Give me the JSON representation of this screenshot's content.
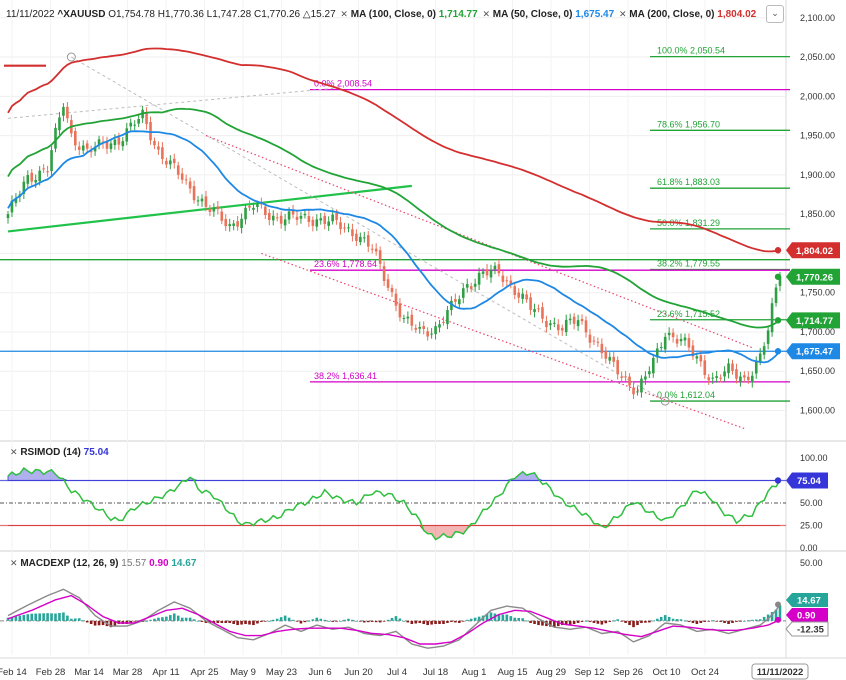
{
  "header": {
    "date": "11/11/2022",
    "symbol": "^XAUUSD",
    "ohlc": {
      "o": "1,754.78",
      "h": "1,770.36",
      "l": "1,747.28",
      "c": "1,770.26",
      "chg": "15.27"
    },
    "ma100": {
      "label": "MA (100, Close, 0)",
      "value": "1,714.77",
      "color": "#21a336"
    },
    "ma50": {
      "label": "MA (50, Close, 0)",
      "value": "1,675.47",
      "color": "#1e88e5"
    },
    "ma200": {
      "label": "MA (200, Close, 0)",
      "value": "1,804.02",
      "color": "#d32f2f"
    }
  },
  "rsi_legend": {
    "label": "RSIMOD (14)",
    "value": "75.04",
    "color": "#3535d9"
  },
  "macd_legend": {
    "label": "MACDEXP (12, 26, 9)",
    "v1": "15.57",
    "v2": "0.90",
    "v3": "14.67"
  },
  "chart_data": [
    {
      "type": "candlestick",
      "title": "^XAUUSD",
      "y_ticks": [
        "2,100.00",
        "2,050.00",
        "2,000.00",
        "1,950.00",
        "1,900.00",
        "1,850.00",
        "1,800.00",
        "1,750.00",
        "1,700.00",
        "1,650.00",
        "1,600.00"
      ],
      "ylim": [
        1565,
        2115
      ],
      "x_ticks": [
        "Feb 14",
        "Feb 28",
        "Mar 14",
        "Mar 28",
        "Apr 11",
        "Apr 25",
        "May 9",
        "May 23",
        "Jun 6",
        "Jun 20",
        "Jul 4",
        "Jul 18",
        "Aug 1",
        "Aug 15",
        "Aug 29",
        "Sep 12",
        "Sep 26",
        "Oct 10",
        "Oct 24"
      ],
      "x_highlight": "11/11/2022",
      "close_keypoints": [
        [
          0,
          1850
        ],
        [
          5,
          1895
        ],
        [
          10,
          1910
        ],
        [
          14,
          1990
        ],
        [
          16,
          1950
        ],
        [
          20,
          1930
        ],
        [
          28,
          1945
        ],
        [
          34,
          1975
        ],
        [
          38,
          1930
        ],
        [
          44,
          1895
        ],
        [
          50,
          1860
        ],
        [
          56,
          1835
        ],
        [
          62,
          1860
        ],
        [
          68,
          1845
        ],
        [
          76,
          1845
        ],
        [
          82,
          1840
        ],
        [
          88,
          1825
        ],
        [
          92,
          1805
        ],
        [
          96,
          1760
        ],
        [
          100,
          1715
        ],
        [
          104,
          1700
        ],
        [
          108,
          1705
        ],
        [
          112,
          1730
        ],
        [
          116,
          1760
        ],
        [
          120,
          1775
        ],
        [
          124,
          1775
        ],
        [
          128,
          1755
        ],
        [
          132,
          1730
        ],
        [
          136,
          1715
        ],
        [
          140,
          1705
        ],
        [
          144,
          1715
        ],
        [
          148,
          1690
        ],
        [
          152,
          1660
        ],
        [
          156,
          1640
        ],
        [
          159,
          1625
        ],
        [
          163,
          1660
        ],
        [
          166,
          1700
        ],
        [
          170,
          1690
        ],
        [
          174,
          1665
        ],
        [
          178,
          1640
        ],
        [
          182,
          1650
        ],
        [
          186,
          1640
        ],
        [
          188,
          1652
        ],
        [
          190,
          1668
        ],
        [
          192,
          1700
        ],
        [
          194,
          1755
        ],
        [
          195,
          1770.26
        ]
      ],
      "ma_last": [
        {
          "name": "MA (200, Close, 0)",
          "value": 1804.02,
          "color": "#d32f2f",
          "label": "1,804.02"
        },
        {
          "name": "MA (100, Close, 0)",
          "value": 1714.77,
          "color": "#21a336",
          "label": "1,714.77"
        },
        {
          "name": "MA (50, Close, 0)",
          "value": 1675.47,
          "color": "#1e88e5",
          "label": "1,675.47"
        }
      ],
      "last_price": {
        "value": 1770.26,
        "label": "1,770.26"
      },
      "fib_upper": [
        {
          "pct": "100.0%",
          "value": 2050.54,
          "label": "100.0% 2,050.54"
        },
        {
          "pct": "78.6%",
          "value": 1956.7,
          "label": "78.6% 1,956.70"
        },
        {
          "pct": "61.8%",
          "value": 1883.03,
          "label": "61.8% 1,883.03"
        },
        {
          "pct": "50.0%",
          "value": 1831.29,
          "label": "50.0% 1,831.29"
        },
        {
          "pct": "38.2%",
          "value": 1779.55,
          "label": "38.2% 1,779.55"
        },
        {
          "pct": "23.6%",
          "value": 1715.52,
          "label": "23.6% 1,715.52"
        },
        {
          "pct": "0.0%",
          "value": 1612.04,
          "label": "0.0% 1,612.04"
        }
      ],
      "fib_lower": [
        {
          "pct": "0.0%",
          "value": 2008.54,
          "label": "0.0% 2,008.54"
        },
        {
          "pct": "23.6%",
          "value": 1778.64,
          "label": "23.6% 1,778.64"
        },
        {
          "pct": "38.2%",
          "value": 1636.41,
          "label": "38.2% 1,636.41"
        }
      ],
      "colors": {
        "up": "#2f9e44",
        "down": "#e8735a",
        "fib_upper": "#21a336",
        "fib_lower": "#d400c8"
      }
    },
    {
      "type": "line",
      "title": "RSIMOD (14)",
      "y_ticks": [
        "100.00",
        "75.00",
        "50.00",
        "25.00",
        "0.00"
      ],
      "ylim": [
        0,
        100
      ],
      "levels": [
        75,
        50,
        25
      ],
      "last_value": {
        "value": 75.04,
        "label": "75.04"
      },
      "keypoints": [
        [
          0,
          80
        ],
        [
          4,
          86
        ],
        [
          8,
          85
        ],
        [
          12,
          84
        ],
        [
          16,
          64
        ],
        [
          20,
          52
        ],
        [
          24,
          40
        ],
        [
          26,
          33
        ],
        [
          28,
          30
        ],
        [
          32,
          45
        ],
        [
          36,
          52
        ],
        [
          40,
          60
        ],
        [
          44,
          72
        ],
        [
          46,
          80
        ],
        [
          48,
          66
        ],
        [
          52,
          58
        ],
        [
          56,
          40
        ],
        [
          58,
          30
        ],
        [
          60,
          26
        ],
        [
          64,
          30
        ],
        [
          68,
          34
        ],
        [
          72,
          45
        ],
        [
          76,
          52
        ],
        [
          80,
          62
        ],
        [
          84,
          54
        ],
        [
          88,
          50
        ],
        [
          92,
          62
        ],
        [
          96,
          60
        ],
        [
          100,
          50
        ],
        [
          104,
          30
        ],
        [
          106,
          15
        ],
        [
          108,
          12
        ],
        [
          112,
          14
        ],
        [
          116,
          20
        ],
        [
          120,
          40
        ],
        [
          124,
          58
        ],
        [
          128,
          80
        ],
        [
          132,
          84
        ],
        [
          136,
          70
        ],
        [
          140,
          52
        ],
        [
          144,
          42
        ],
        [
          148,
          30
        ],
        [
          150,
          22
        ],
        [
          154,
          35
        ],
        [
          158,
          52
        ],
        [
          162,
          40
        ],
        [
          166,
          30
        ],
        [
          170,
          45
        ],
        [
          174,
          65
        ],
        [
          178,
          54
        ],
        [
          180,
          42
        ],
        [
          184,
          30
        ],
        [
          188,
          38
        ],
        [
          192,
          62
        ],
        [
          195,
          75.04
        ]
      ]
    },
    {
      "type": "histogram",
      "title": "MACDEXP (12, 26, 9)",
      "ylim": [
        -22,
        55
      ],
      "axis_labels": [
        "50.00",
        "-12.35"
      ],
      "last_values": [
        {
          "value": 14.67,
          "label": "14.67"
        },
        {
          "value": 0.9,
          "label": "0.90"
        },
        {
          "value": -12.35,
          "label": "-12.35"
        }
      ],
      "macd_keypoints": [
        [
          0,
          5
        ],
        [
          5,
          15
        ],
        [
          10,
          24
        ],
        [
          14,
          30
        ],
        [
          18,
          22
        ],
        [
          22,
          5
        ],
        [
          26,
          -5
        ],
        [
          30,
          -5
        ],
        [
          34,
          0
        ],
        [
          38,
          10
        ],
        [
          42,
          18
        ],
        [
          46,
          12
        ],
        [
          50,
          0
        ],
        [
          54,
          -8
        ],
        [
          58,
          -16
        ],
        [
          62,
          -18
        ],
        [
          66,
          -12
        ],
        [
          70,
          -4
        ],
        [
          74,
          -10
        ],
        [
          78,
          -4
        ],
        [
          82,
          -8
        ],
        [
          86,
          -6
        ],
        [
          90,
          -12
        ],
        [
          94,
          -14
        ],
        [
          98,
          -10
        ],
        [
          102,
          -22
        ],
        [
          106,
          -26
        ],
        [
          110,
          -24
        ],
        [
          114,
          -18
        ],
        [
          118,
          -4
        ],
        [
          122,
          10
        ],
        [
          126,
          14
        ],
        [
          130,
          12
        ],
        [
          134,
          2
        ],
        [
          138,
          -6
        ],
        [
          142,
          -8
        ],
        [
          146,
          -6
        ],
        [
          150,
          -12
        ],
        [
          154,
          -10
        ],
        [
          158,
          -20
        ],
        [
          162,
          -14
        ],
        [
          166,
          -2
        ],
        [
          170,
          -4
        ],
        [
          174,
          -10
        ],
        [
          178,
          -8
        ],
        [
          182,
          -12
        ],
        [
          186,
          -8
        ],
        [
          190,
          -4
        ],
        [
          192,
          2
        ],
        [
          194,
          10
        ],
        [
          195,
          15.57
        ]
      ],
      "signal_keypoints": [
        [
          0,
          2
        ],
        [
          6,
          10
        ],
        [
          12,
          20
        ],
        [
          16,
          24
        ],
        [
          20,
          15
        ],
        [
          24,
          4
        ],
        [
          28,
          -2
        ],
        [
          32,
          -2
        ],
        [
          36,
          4
        ],
        [
          40,
          10
        ],
        [
          44,
          12
        ],
        [
          48,
          6
        ],
        [
          52,
          -2
        ],
        [
          56,
          -10
        ],
        [
          60,
          -14
        ],
        [
          64,
          -14
        ],
        [
          68,
          -10
        ],
        [
          72,
          -8
        ],
        [
          76,
          -7
        ],
        [
          80,
          -7
        ],
        [
          84,
          -7
        ],
        [
          88,
          -9
        ],
        [
          92,
          -12
        ],
        [
          96,
          -13
        ],
        [
          100,
          -16
        ],
        [
          104,
          -22
        ],
        [
          108,
          -22
        ],
        [
          112,
          -20
        ],
        [
          116,
          -12
        ],
        [
          120,
          -2
        ],
        [
          124,
          6
        ],
        [
          128,
          10
        ],
        [
          132,
          9
        ],
        [
          136,
          3
        ],
        [
          140,
          -3
        ],
        [
          144,
          -5
        ],
        [
          148,
          -7
        ],
        [
          152,
          -10
        ],
        [
          156,
          -13
        ],
        [
          160,
          -15
        ],
        [
          164,
          -10
        ],
        [
          168,
          -5
        ],
        [
          172,
          -6
        ],
        [
          176,
          -8
        ],
        [
          180,
          -9
        ],
        [
          184,
          -9
        ],
        [
          188,
          -7
        ],
        [
          192,
          -4
        ],
        [
          195,
          0.9
        ]
      ],
      "colors": {
        "macd": "#8a8a8a",
        "signal": "#d400c8",
        "hist_pos": "#26a69a",
        "hist_neg": "#8b1a1a"
      }
    }
  ]
}
